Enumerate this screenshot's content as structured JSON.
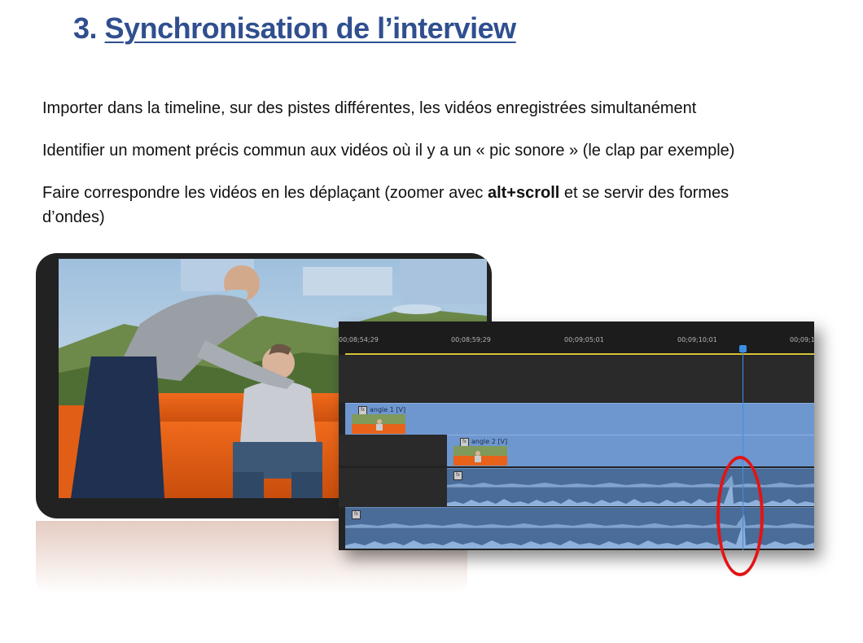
{
  "page": {
    "title_number": "3.",
    "title_text": "Synchronisation de l’interview",
    "accent_color": "#2f4f8f"
  },
  "instructions": {
    "line1": "Importer dans la timeline, sur des pistes différentes, les vidéos enregistrées simultanément",
    "line2": "Identifier un moment précis commun aux vidéos où il y a un « pic sonore » (le clap par exemple)",
    "line3_before": "Faire correspondre les vidéos en les déplaçant (zoomer avec ",
    "line3_bold": "alt+scroll",
    "line3_after": " et se servir des formes",
    "line3_continued": "d’ondes)"
  },
  "timeline": {
    "timecodes": [
      "00;08;54;29",
      "00;08;59;29",
      "00;09;05;01",
      "00;09;10;01",
      "00;09;1"
    ],
    "clips": {
      "video1_label": "angle 1 [V]",
      "video2_label": "angle 2 [V]"
    },
    "playhead_color": "#3c8ee8",
    "highlight_color": "#e31414"
  }
}
